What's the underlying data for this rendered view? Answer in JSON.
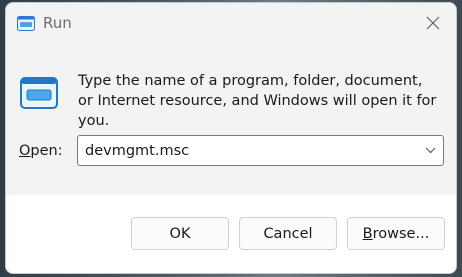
{
  "window": {
    "title": "Run",
    "close_icon": "close-icon"
  },
  "dialog": {
    "description": "Type the name of a program, folder, document, or Internet resource, and Windows will open it for you.",
    "open_label_prefix": "O",
    "open_label_rest": "pen:",
    "open_value": "devmgmt.msc"
  },
  "buttons": {
    "ok": "OK",
    "cancel": "Cancel",
    "browse_prefix": "B",
    "browse_rest": "rowse..."
  },
  "colors": {
    "accent": "#0078d4",
    "titlebar": "#f3f3f3",
    "footer": "#ffffff"
  }
}
